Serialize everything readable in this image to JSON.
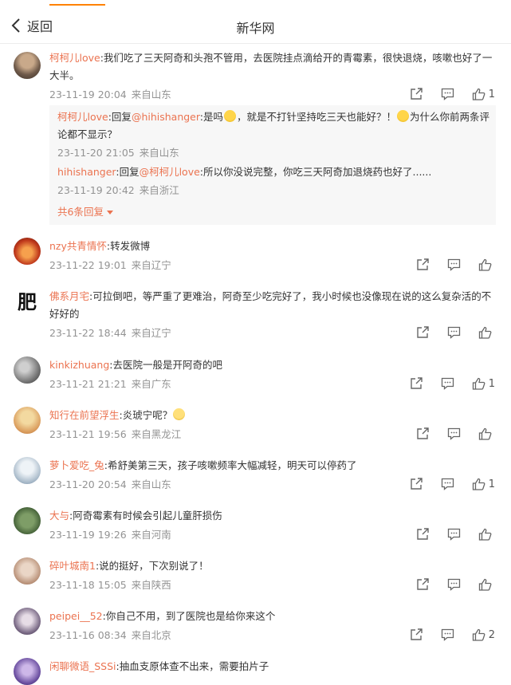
{
  "header": {
    "back_label": "返回",
    "title": "新华网"
  },
  "comments": [
    {
      "user": "柯柯儿love",
      "content": ":我们吃了三天阿奇和头孢不管用，去医院挂点滴给开的青霉素，很快退烧，咳嗽也好了一大半。",
      "time": "23-11-19 20:04",
      "location": "来自山东",
      "likes": "1",
      "replies": [
        {
          "user": "柯柯儿love",
          "prefix": ":回复",
          "at": "@hihishanger",
          "text1": ":是吗",
          "text2": "，就是不打针坚持吃三天也能好？！",
          "text3": "为什么你前两条评论都不显示？",
          "time": "23-11-20 21:05",
          "location": "来自山东"
        },
        {
          "user": "hihishanger",
          "prefix": ":回复",
          "at": "@柯柯儿love",
          "text1": ":所以你没说完整，你吃三天阿奇加退烧药也好了......",
          "time": "23-11-19 20:42",
          "location": "来自浙江"
        }
      ],
      "more_replies": "共6条回复"
    },
    {
      "user": "nzy共青情怀",
      "content": ":转发微博",
      "time": "23-11-22 19:01",
      "location": "来自辽宁",
      "likes": ""
    },
    {
      "user": "佛系月宅",
      "content": ":可拉倒吧，等严重了更难治，阿奇至少吃完好了，我小时候也没像现在说的这么复杂活的不好好的",
      "time": "23-11-22 18:44",
      "location": "来自辽宁",
      "likes": ""
    },
    {
      "user": "kinkizhuang",
      "content": ":去医院一般是开阿奇的吧",
      "time": "23-11-21 21:21",
      "location": "来自广东",
      "likes": "1"
    },
    {
      "user": "知行在前望浮生",
      "content": ":炎琥宁呢？",
      "time": "23-11-21 19:56",
      "location": "来自黑龙江",
      "likes": ""
    },
    {
      "user": "萝卜爱吃_兔",
      "content": ":希舒美第三天，孩子咳嗽频率大幅减轻，明天可以停药了",
      "time": "23-11-20 20:54",
      "location": "来自山东",
      "likes": "1"
    },
    {
      "user": "大与",
      "content": ":阿奇霉素有时候会引起儿童肝损伤",
      "time": "23-11-19 19:26",
      "location": "来自河南",
      "likes": ""
    },
    {
      "user": "碎叶城南1",
      "content": ":说的挺好，下次别说了！",
      "time": "23-11-18 15:05",
      "location": "来自陕西",
      "likes": ""
    },
    {
      "user": "peipei__52",
      "content": ":你自己不用，到了医院也是给你来这个",
      "time": "23-11-16 08:34",
      "location": "来自北京",
      "likes": "2"
    },
    {
      "user": "闲聊微语_SSSi",
      "content": ":抽血支原体查不出来，需要拍片子",
      "time": "",
      "location": "",
      "likes": ""
    }
  ],
  "colors": {
    "accent": "#ff8200",
    "username": "#eb7350",
    "meta": "#939393"
  }
}
